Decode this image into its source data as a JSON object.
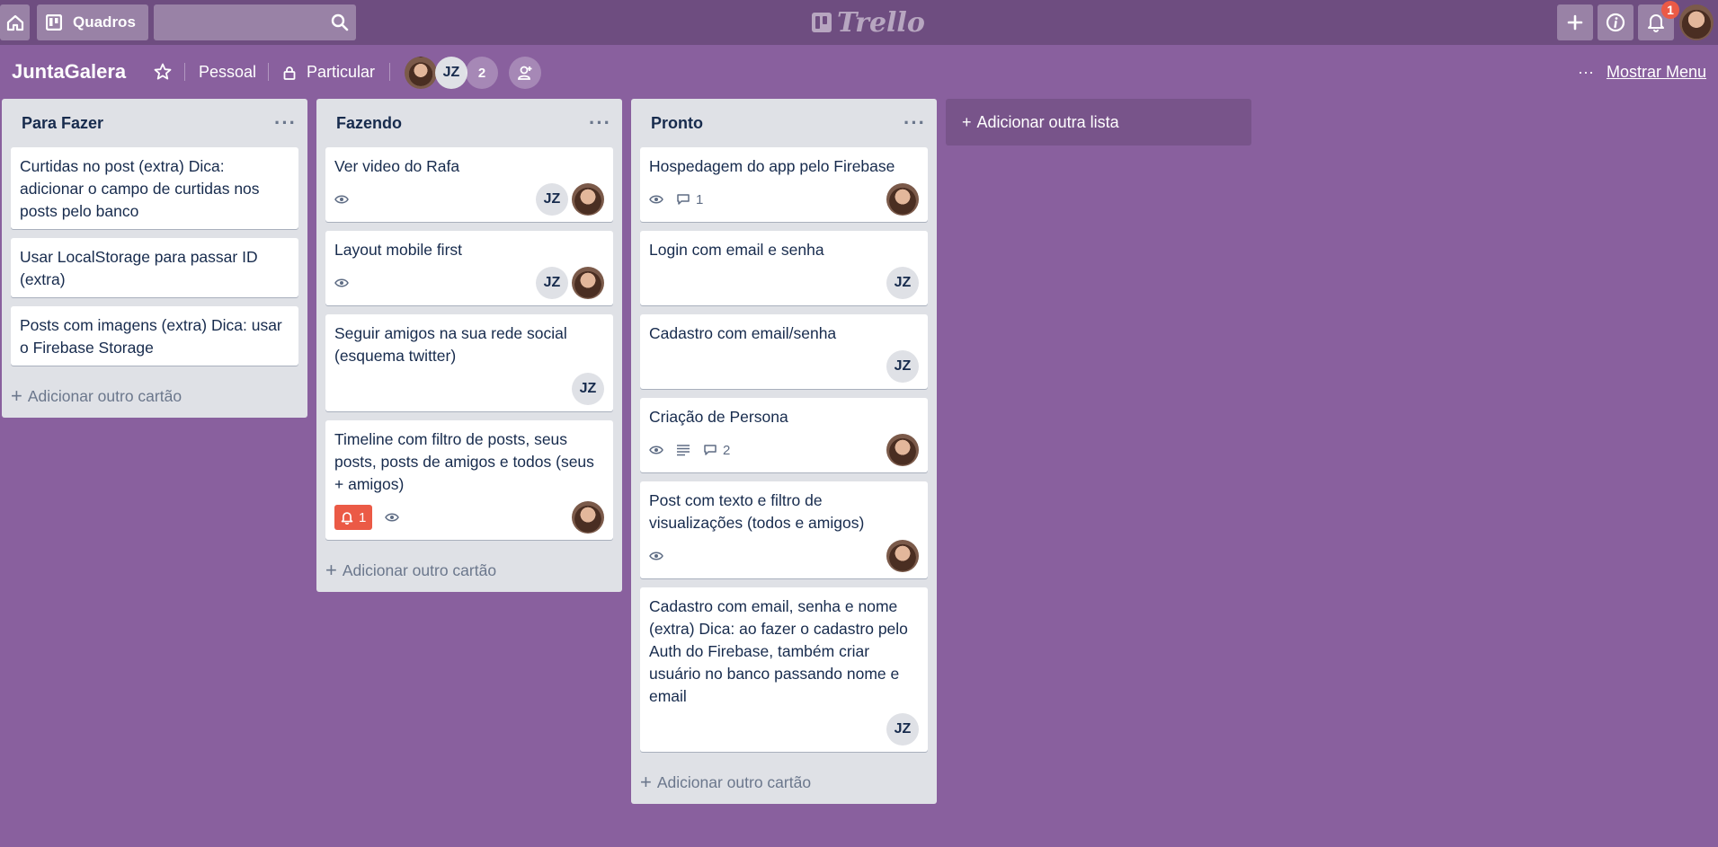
{
  "header": {
    "boards_label": "Quadros",
    "search_placeholder": "",
    "logo_text": "Trello",
    "notification_count": "1"
  },
  "board": {
    "title": "JuntaGalera",
    "team": "Pessoal",
    "visibility": "Particular",
    "member_initials": "JZ",
    "extra_members": "2",
    "show_menu": "Mostrar Menu"
  },
  "lists": [
    {
      "title": "Para Fazer",
      "cards": [
        {
          "title": "Curtidas no post (extra) Dica: adicionar o campo de curtidas nos posts pelo banco"
        },
        {
          "title": "Usar LocalStorage para passar ID (extra)"
        },
        {
          "title": "Posts com imagens (extra) Dica: usar o Firebase Storage"
        }
      ],
      "add_card": "Adicionar outro cartão"
    },
    {
      "title": "Fazendo",
      "cards": [
        {
          "title": "Ver video do Rafa",
          "members": [
            "JZ",
            "photo"
          ]
        },
        {
          "title": "Layout mobile first",
          "members": [
            "JZ",
            "photo"
          ]
        },
        {
          "title": "Seguir amigos na sua rede social (esquema twitter)",
          "members": [
            "JZ"
          ]
        },
        {
          "title": "Timeline com filtro de posts, seus posts, posts de amigos e todos (seus + amigos)",
          "notification": "1",
          "members": [
            "photo"
          ]
        }
      ],
      "add_card": "Adicionar outro cartão"
    },
    {
      "title": "Pronto",
      "cards": [
        {
          "title": "Hospedagem do app pelo Firebase",
          "comments": "1",
          "members": [
            "photo"
          ]
        },
        {
          "title": "Login com email e senha",
          "members": [
            "JZ"
          ]
        },
        {
          "title": "Cadastro com email/senha",
          "members": [
            "JZ"
          ]
        },
        {
          "title": "Criação de Persona",
          "comments": "2",
          "members": [
            "photo"
          ]
        },
        {
          "title": "Post com texto e filtro de visualizações (todos e amigos)",
          "members": [
            "photo"
          ]
        },
        {
          "title": "Cadastro com email, senha e nome (extra) Dica: ao fazer o cadastro pelo Auth do Firebase, também criar usuário no banco passando nome e email",
          "members": [
            "JZ"
          ]
        }
      ],
      "add_card": "Adicionar outro cartão"
    }
  ],
  "add_list": "Adicionar outra lista",
  "icons": [
    "home-icon",
    "board-icon",
    "search-icon",
    "plus-icon",
    "info-icon",
    "bell-icon",
    "star-icon",
    "lock-icon",
    "add-member-icon",
    "ellipsis-icon",
    "eye-icon",
    "comment-icon",
    "description-icon"
  ]
}
